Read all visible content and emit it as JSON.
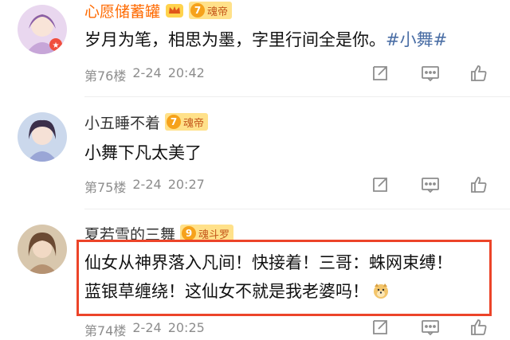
{
  "comments": [
    {
      "username": "心愿储蓄罐",
      "level": "7",
      "rank": "魂帝",
      "text": "岁月为笔，相思为墨，字里行间全是你。",
      "hashtag": "#小舞#",
      "floor": "第76楼",
      "date": "2-24",
      "time": "20:42"
    },
    {
      "username": "小五睡不着",
      "level": "7",
      "rank": "魂帝",
      "text": "小舞下凡太美了",
      "floor": "第75楼",
      "date": "2-24",
      "time": "20:27"
    },
    {
      "username": "夏若雪的三舞",
      "level": "9",
      "rank": "魂斗罗",
      "line1": "仙女从神界落入凡间！快接着！三哥：蛛网束缚！",
      "line2": "蓝银草缠绕！这仙女不就是我老婆吗！",
      "floor": "第74楼",
      "date": "2-24",
      "time": "20:25"
    }
  ],
  "colors": {
    "vip_name": "#ff6a00",
    "hashtag": "#4a6ea5",
    "highlight_border": "#ec4429",
    "level_badge": "#ffe18a"
  },
  "icons": [
    "crown-icon",
    "share-icon",
    "comment-icon",
    "like-icon",
    "dog-emoji"
  ]
}
